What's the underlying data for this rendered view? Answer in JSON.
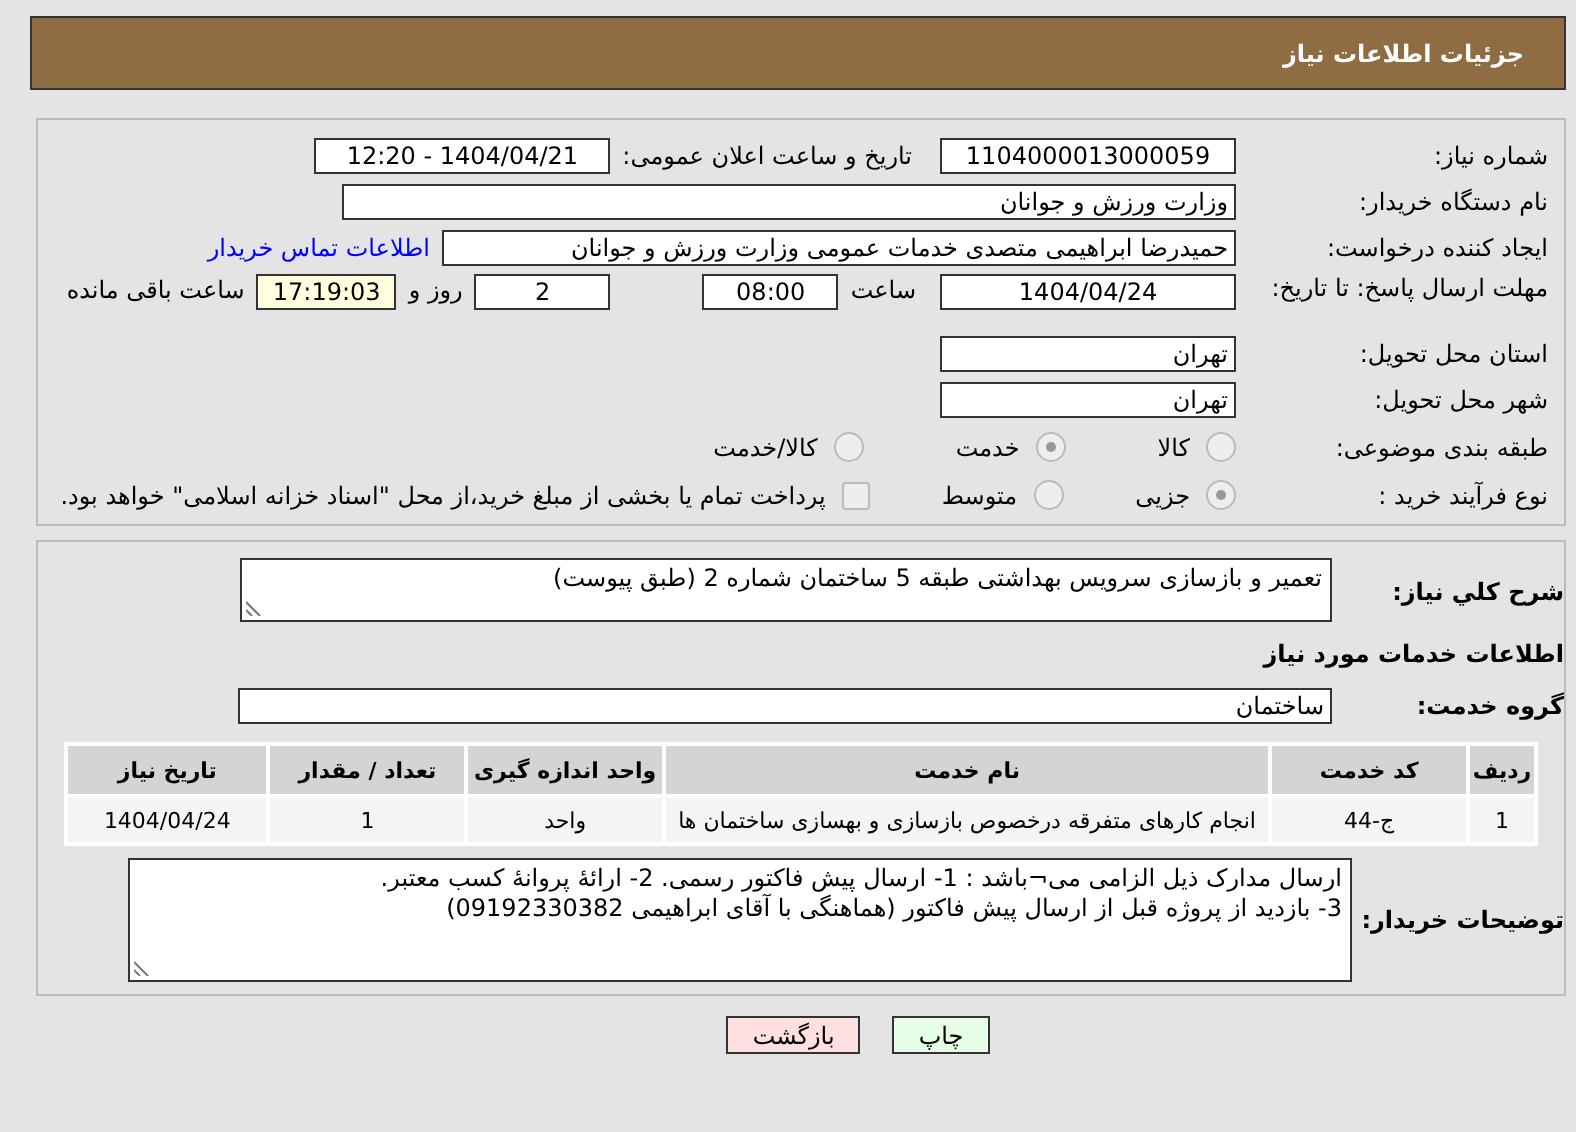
{
  "header": {
    "title": "جزئیات اطلاعات نیاز"
  },
  "need_number": {
    "label": "شماره نیاز:",
    "value": "1104000013000059"
  },
  "announce": {
    "label": "تاریخ و ساعت اعلان عمومی:",
    "value": "1404/04/21 - 12:20"
  },
  "buyer_org": {
    "label": "نام دستگاه خریدار:",
    "value": "وزارت ورزش و جوانان"
  },
  "requester": {
    "label": "ایجاد کننده درخواست:",
    "value": "حمیدرضا ابراهیمی متصدی خدمات عمومی وزارت ورزش و جوانان",
    "link": "اطلاعات تماس خریدار"
  },
  "deadline": {
    "label": "مهلت ارسال پاسخ: تا تاریخ:",
    "date": "1404/04/24",
    "time_label": "ساعت",
    "time": "08:00",
    "days": "2",
    "days_label": "روز و",
    "remaining": "17:19:03",
    "remaining_label": "ساعت باقی مانده"
  },
  "province": {
    "label": "استان محل تحویل:",
    "value": "تهران"
  },
  "city": {
    "label": "شهر محل تحویل:",
    "value": "تهران"
  },
  "category": {
    "label": "طبقه بندی موضوعی:",
    "options": [
      {
        "label": "کالا",
        "selected": false
      },
      {
        "label": "خدمت",
        "selected": true
      },
      {
        "label": "کالا/خدمت",
        "selected": false
      }
    ]
  },
  "process": {
    "label": "نوع فرآیند خرید :",
    "options": [
      {
        "label": "جزیی",
        "selected": true
      },
      {
        "label": "متوسط",
        "selected": false
      }
    ],
    "payment": {
      "label": "پرداخت تمام یا بخشی از مبلغ خرید،از محل \"اسناد خزانه اسلامی\" خواهد بود.",
      "checked": false
    }
  },
  "description": {
    "label": "شرح کلي نياز:",
    "value": "تعمیر و بازسازی سرویس بهداشتی طبقه 5 ساختمان شماره 2 (طبق پیوست)"
  },
  "services_title": "اطلاعات خدمات مورد نياز",
  "service_group": {
    "label": "گروه خدمت:",
    "value": "ساختمان"
  },
  "table": {
    "columns": [
      "ردیف",
      "کد خدمت",
      "نام خدمت",
      "واحد اندازه گیری",
      "تعداد / مقدار",
      "تاریخ نیاز"
    ],
    "rows": [
      [
        "1",
        "ج-44",
        "انجام کارهای متفرقه درخصوص بازسازی و بهسازی ساختمان ها",
        "واحد",
        "1",
        "1404/04/24"
      ]
    ]
  },
  "buyer_notes": {
    "label": "توضیحات خریدار:",
    "lines": [
      "ارسال مدارک ذیل الزامی می¬باشد : 1- ارسال پیش فاکتور رسمی. 2- ارائۀ پروانۀ کسب معتبر.",
      "3- بازدید از پروژه قبل از ارسال پیش فاکتور (هماهنگی با آقای ابراهیمی 09192330382)"
    ]
  },
  "buttons": [
    {
      "kind": "print",
      "label": "چاپ"
    },
    {
      "kind": "back",
      "label": "بازگشت"
    }
  ]
}
